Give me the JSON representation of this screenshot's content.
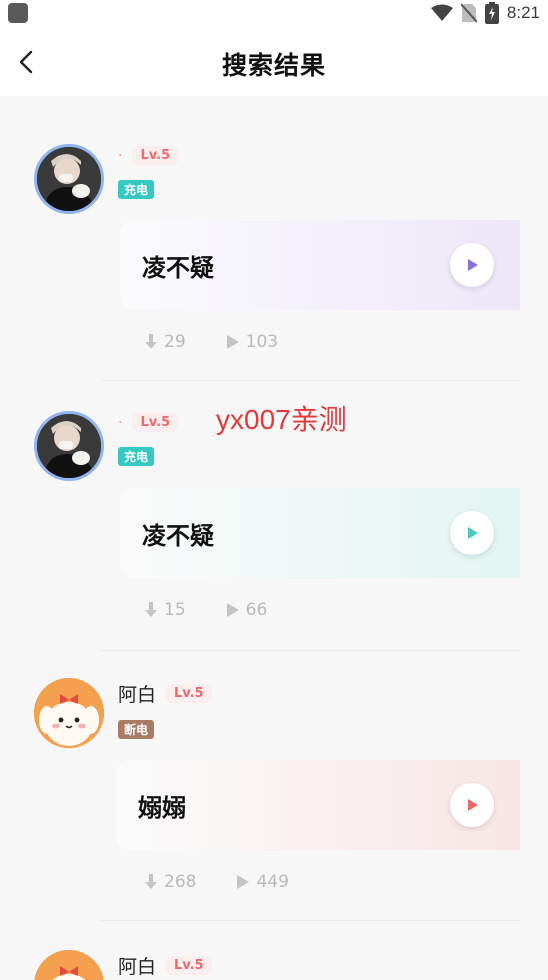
{
  "status_bar": {
    "time": "8:21"
  },
  "nav": {
    "title": "搜索结果"
  },
  "watermark": "yx007亲测",
  "results": [
    {
      "user": "·",
      "level": "Lv.5",
      "badge": "充电",
      "song": "凌不疑",
      "downloads": "29",
      "plays": "103",
      "theme": "purple",
      "play_color": "#8a6fd8"
    },
    {
      "user": "·",
      "level": "Lv.5",
      "badge": "充电",
      "song": "凌不疑",
      "downloads": "15",
      "plays": "66",
      "theme": "mint",
      "play_color": "#4cc9bd"
    },
    {
      "user": "阿白",
      "level": "Lv.5",
      "badge": "断电",
      "song": "嫋嫋",
      "downloads": "268",
      "plays": "449",
      "theme": "pink",
      "play_color": "#e86a6a"
    },
    {
      "user": "阿白",
      "level": "Lv.5"
    }
  ]
}
